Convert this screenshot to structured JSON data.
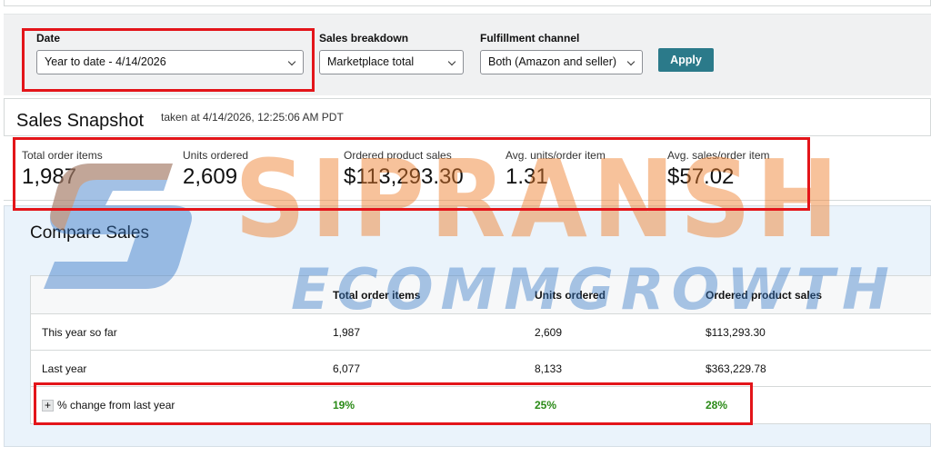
{
  "filters": {
    "date_label": "Date",
    "date_value": "Year to date - 4/14/2026",
    "breakdown_label": "Sales breakdown",
    "breakdown_value": "Marketplace total",
    "channel_label": "Fulfillment channel",
    "channel_value": "Both (Amazon and seller)",
    "apply_label": "Apply"
  },
  "snapshot": {
    "title": "Sales Snapshot",
    "subtitle": "taken at 4/14/2026, 12:25:06 AM PDT",
    "metrics": [
      {
        "label": "Total order items",
        "value": "1,987"
      },
      {
        "label": "Units ordered",
        "value": "2,609"
      },
      {
        "label": "Ordered product sales",
        "value": "$113,293.30"
      },
      {
        "label": "Avg. units/order item",
        "value": "1.31"
      },
      {
        "label": "Avg. sales/order item",
        "value": "$57.02"
      }
    ]
  },
  "compare": {
    "title": "Compare Sales",
    "headers": [
      "",
      "Total order items",
      "Units ordered",
      "Ordered product sales"
    ],
    "rows": [
      {
        "label": "This year so far",
        "values": [
          "1,987",
          "2,609",
          "$113,293.30"
        ]
      },
      {
        "label": "Last year",
        "values": [
          "6,077",
          "8,133",
          "$363,229.78"
        ]
      },
      {
        "label": "% change from last year",
        "values": [
          "19%",
          "25%",
          "28%"
        ]
      }
    ],
    "positive_color": "#2a8a17"
  },
  "watermark": {
    "line1": "SIPRANSH",
    "line2": "ECOMMGROWTH"
  },
  "colors": {
    "accent": "#2b7a8a",
    "highlight": "#e3151a"
  }
}
